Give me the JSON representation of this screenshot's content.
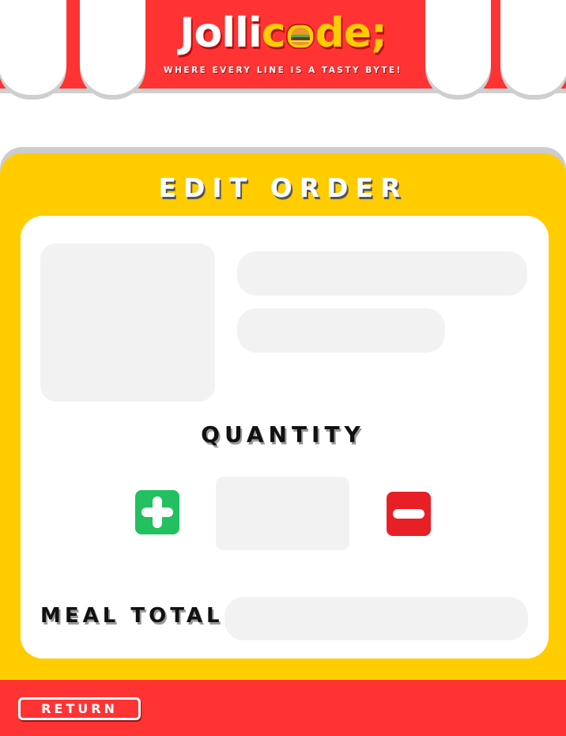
{
  "header": {
    "logo": {
      "part1": "Jolli",
      "part2": "c",
      "part3": "de;",
      "burger_icon": "burger-icon"
    },
    "tagline": "WHERE EVERY LINE IS A TASTY BYTE!"
  },
  "edit_order": {
    "title": "EDIT ORDER",
    "quantity_label": "QUANTITY",
    "meal_total_label": "MEAL TOTAL",
    "increase_icon": "plus-icon",
    "decrease_icon": "minus-icon"
  },
  "footer": {
    "return_label": "RETURN"
  },
  "colors": {
    "awning_red": "#ff3333",
    "panel_yellow": "#ffcc00",
    "plus_green": "#22c060",
    "minus_red": "#e82025",
    "placeholder_gray": "#f2f2f2"
  }
}
